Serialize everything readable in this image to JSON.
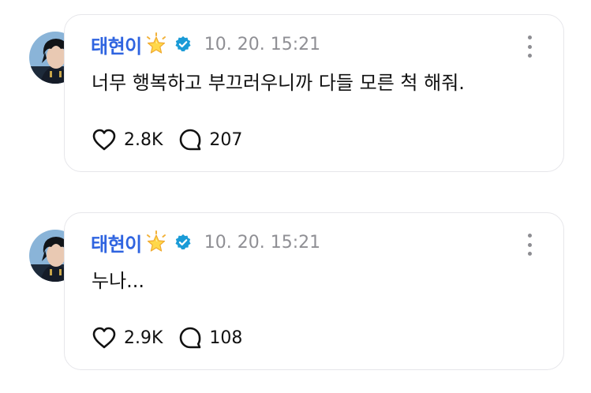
{
  "posts": [
    {
      "username": "태현이",
      "badge_icon": "glowing-star-icon",
      "verified_icon": "verified-badge-icon",
      "timestamp": "10. 20. 15:21",
      "text": "너무 행복하고 부끄러우니까 다들 모른 척 해줘.",
      "likes": "2.8K",
      "comments": "207"
    },
    {
      "username": "태현이",
      "badge_icon": "glowing-star-icon",
      "verified_icon": "verified-badge-icon",
      "timestamp": "10. 20. 15:21",
      "text": "누나...",
      "likes": "2.9K",
      "comments": "108"
    }
  ],
  "colors": {
    "username": "#2f64e0",
    "verified": "#1a9bd7",
    "timestamp": "#8f8f94",
    "card_border": "#e6e6ea"
  }
}
